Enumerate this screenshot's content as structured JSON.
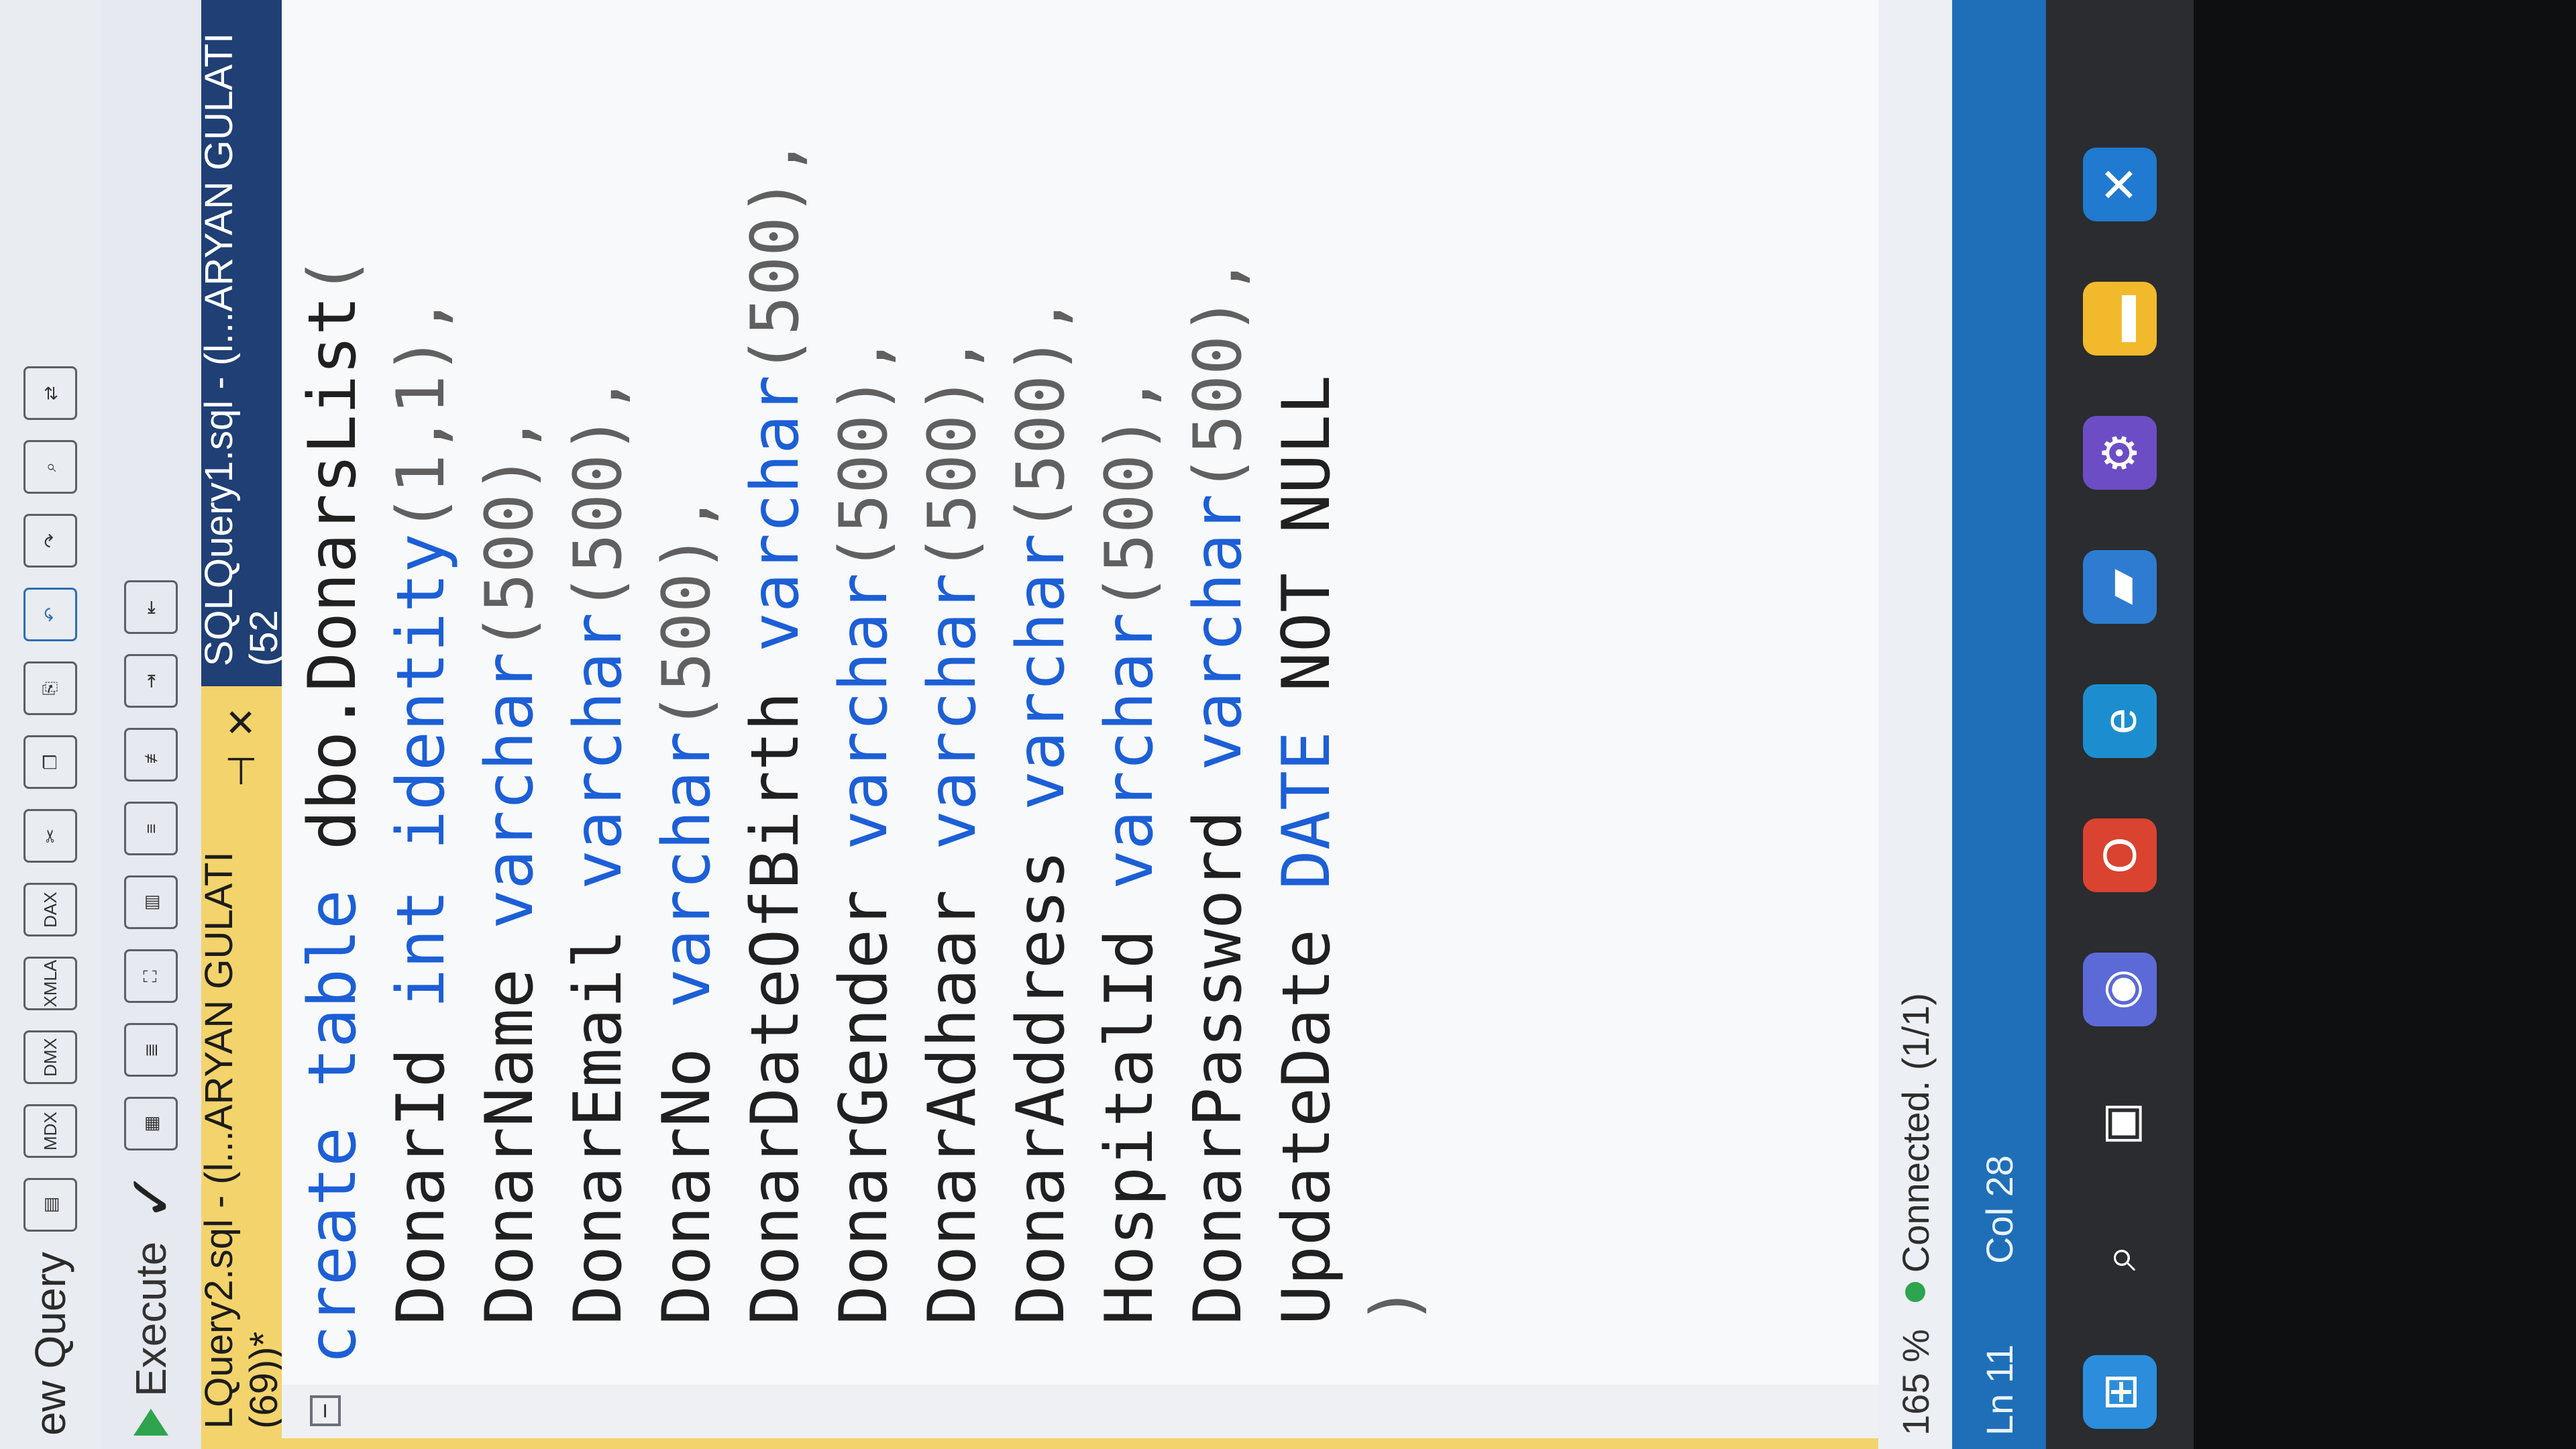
{
  "menubar": {
    "new_query": "ew Query",
    "icons": [
      "query-icon",
      "mdx-icon",
      "dmx-icon",
      "xmla-icon",
      "dax-icon",
      "cut-icon",
      "copy-icon",
      "paste-icon",
      "undo-icon",
      "redo-icon",
      "search-icon",
      "replace-icon"
    ]
  },
  "toolbar": {
    "execute_label": "Execute",
    "icons": [
      "parse-check-icon",
      "results-grid-icon",
      "results-text-icon",
      "plan-icon",
      "stats-icon",
      "comment-icon",
      "uncomment-icon",
      "indent-icon",
      "outdent-icon"
    ]
  },
  "tabs": [
    {
      "label": "LQuery2.sql - (l...ARYAN GULATI (69))*",
      "active": true
    },
    {
      "label": "SQLQuery1.sql - (l...ARYAN GULATI (52",
      "active": false
    }
  ],
  "code_lines": [
    [
      [
        "kw",
        "create table "
      ],
      [
        "id",
        "dbo.DonarsList"
      ],
      [
        "pun",
        "("
      ]
    ],
    [
      [
        "id",
        " DonarId "
      ],
      [
        "kw",
        "int identity"
      ],
      [
        "pun",
        "(1,1),"
      ]
    ],
    [
      [
        "id",
        " DonarName "
      ],
      [
        "kw",
        "varchar"
      ],
      [
        "pun",
        "(500),"
      ]
    ],
    [
      [
        "id",
        " DonarEmail "
      ],
      [
        "kw",
        "varchar"
      ],
      [
        "pun",
        "(500),"
      ]
    ],
    [
      [
        "id",
        " DonarNo "
      ],
      [
        "kw",
        "varchar"
      ],
      [
        "pun",
        "(500),"
      ]
    ],
    [
      [
        "id",
        " DonarDateOfBirth "
      ],
      [
        "kw",
        "varchar"
      ],
      [
        "pun",
        "(500),"
      ]
    ],
    [
      [
        "id",
        " DonarGender "
      ],
      [
        "kw",
        "varchar"
      ],
      [
        "pun",
        "(500),"
      ]
    ],
    [
      [
        "id",
        " DonarAdhaar "
      ],
      [
        "kw",
        "varchar"
      ],
      [
        "pun",
        "(500),"
      ]
    ],
    [
      [
        "id",
        " DonarAddress "
      ],
      [
        "kw",
        "varchar"
      ],
      [
        "pun",
        "(500),"
      ]
    ],
    [
      [
        "id",
        " HospitalId "
      ],
      [
        "kw",
        "varchar"
      ],
      [
        "pun",
        "(500),"
      ]
    ],
    [
      [
        "id",
        " DonarPassword "
      ],
      [
        "kw",
        "varchar"
      ],
      [
        "pun",
        "(500),"
      ]
    ],
    [
      [
        "id",
        " UpdateDate "
      ],
      [
        "kw",
        "DATE"
      ],
      [
        "id",
        " NOT NULL"
      ]
    ],
    [
      [
        "pun",
        " )"
      ]
    ]
  ],
  "bottom": {
    "zoom": "165 %",
    "connection": "Connected. (1/1)"
  },
  "status": {
    "ln": "Ln 11",
    "col": "Col 28"
  },
  "taskbar_icons": [
    "windows-start-icon",
    "search-icon",
    "task-view-icon",
    "chat-icon",
    "office-icon",
    "edge-icon",
    "store-icon",
    "settings-icon",
    "explorer-icon",
    "vscode-icon"
  ]
}
